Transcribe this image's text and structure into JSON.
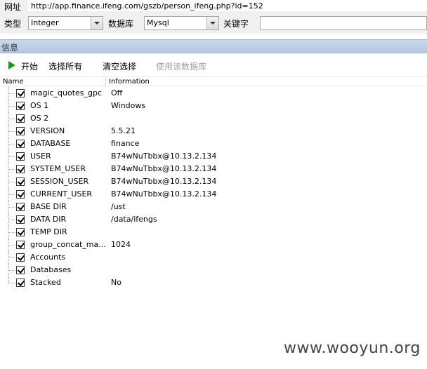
{
  "top": {
    "url_label": "网址",
    "url_value": "http://app.finance.ifeng.com/gszb/person_ifeng.php?id=152",
    "type_label": "类型",
    "type_value": "Integer",
    "db_label": "数据库",
    "db_value": "Mysql",
    "keyword_label": "关键字",
    "keyword_value": ""
  },
  "panel": {
    "title": "信息"
  },
  "toolbar": {
    "start_label": "开始",
    "select_all_label": "选择所有",
    "clear_label": "清空选择",
    "use_db_label": "使用该数据库"
  },
  "grid": {
    "columns": [
      "Name",
      "Information"
    ],
    "rows": [
      {
        "name": "magic_quotes_gpc",
        "info": "Off",
        "checked": true
      },
      {
        "name": "OS 1",
        "info": "Windows",
        "checked": true
      },
      {
        "name": "OS 2",
        "info": "",
        "checked": true
      },
      {
        "name": "VERSION",
        "info": "5.5.21",
        "checked": true
      },
      {
        "name": "DATABASE",
        "info": "finance",
        "checked": true
      },
      {
        "name": "USER",
        "info": "B74wNuTbbx@10.13.2.134",
        "checked": true
      },
      {
        "name": "SYSTEM_USER",
        "info": "B74wNuTbbx@10.13.2.134",
        "checked": true
      },
      {
        "name": "SESSION_USER",
        "info": "B74wNuTbbx@10.13.2.134",
        "checked": true
      },
      {
        "name": "CURRENT_USER",
        "info": "B74wNuTbbx@10.13.2.134",
        "checked": true
      },
      {
        "name": "BASE DIR",
        "info": "/ust",
        "checked": true
      },
      {
        "name": "DATA DIR",
        "info": "/data/ifengs",
        "checked": true
      },
      {
        "name": "TEMP DIR",
        "info": "",
        "checked": true
      },
      {
        "name": "group_concat_ma...",
        "info": "1024",
        "checked": true
      },
      {
        "name": "Accounts",
        "info": "",
        "checked": true
      },
      {
        "name": "Databases",
        "info": "",
        "checked": true
      },
      {
        "name": "Stacked",
        "info": "No",
        "checked": true
      }
    ]
  },
  "watermark": "www.wooyun.org",
  "colors": {
    "panel_header": "#b5c8e0",
    "play_icon": "#1a9a1a"
  }
}
